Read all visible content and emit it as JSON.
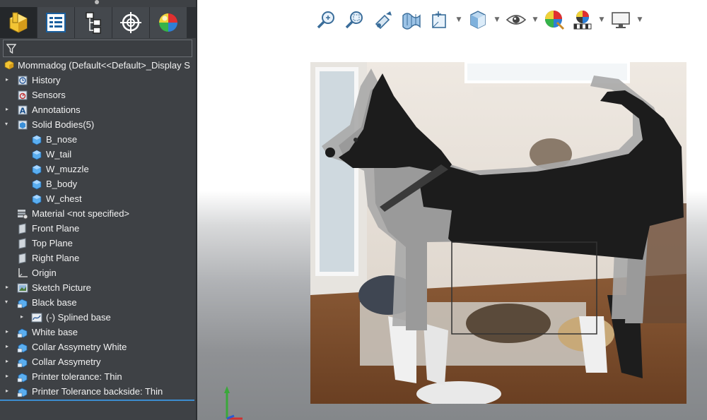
{
  "feature_tree": {
    "root_label": "Mommadog  (Default<<Default>_Display S",
    "items": [
      {
        "label": "History"
      },
      {
        "label": "Sensors"
      },
      {
        "label": "Annotations"
      },
      {
        "label": "Solid Bodies(5)"
      },
      {
        "label": "B_nose"
      },
      {
        "label": "W_tail"
      },
      {
        "label": "W_muzzle"
      },
      {
        "label": "B_body"
      },
      {
        "label": "W_chest"
      },
      {
        "label": "Material <not specified>"
      },
      {
        "label": "Front Plane"
      },
      {
        "label": "Top Plane"
      },
      {
        "label": "Right Plane"
      },
      {
        "label": "Origin"
      },
      {
        "label": "Sketch Picture"
      },
      {
        "label": "Black base"
      },
      {
        "label": "(-) Splined base"
      },
      {
        "label": "White base"
      },
      {
        "label": "Collar Assymetry White"
      },
      {
        "label": "Collar Assymetry"
      },
      {
        "label": "Printer tolerance: Thin"
      },
      {
        "label": "Printer Tolerance backside: Thin"
      }
    ]
  },
  "tabs": [
    {
      "name": "feature-manager-tab-icon"
    },
    {
      "name": "property-manager-tab-icon"
    },
    {
      "name": "configuration-manager-tab-icon"
    },
    {
      "name": "dimxpert-tab-icon"
    },
    {
      "name": "display-manager-tab-icon"
    }
  ],
  "view_toolbar": [
    {
      "name": "zoom-to-fit-icon",
      "dropdown": false
    },
    {
      "name": "zoom-to-area-icon",
      "dropdown": false
    },
    {
      "name": "previous-view-icon",
      "dropdown": false
    },
    {
      "name": "section-view-icon",
      "dropdown": false
    },
    {
      "name": "dynamic-annotation-views-icon",
      "dropdown": true
    },
    {
      "name": "view-orientation-icon",
      "dropdown": true
    },
    {
      "name": "hide-show-items-icon",
      "dropdown": true
    },
    {
      "name": "edit-appearance-icon",
      "dropdown": false
    },
    {
      "name": "apply-scene-icon",
      "dropdown": true
    },
    {
      "name": "view-settings-icon",
      "dropdown": true
    }
  ],
  "colors": {
    "panel_bg": "#3e4145",
    "selection_underline": "#3c8ccf",
    "model_black": "#1c1c1c",
    "model_white": "#9a9a9a"
  }
}
